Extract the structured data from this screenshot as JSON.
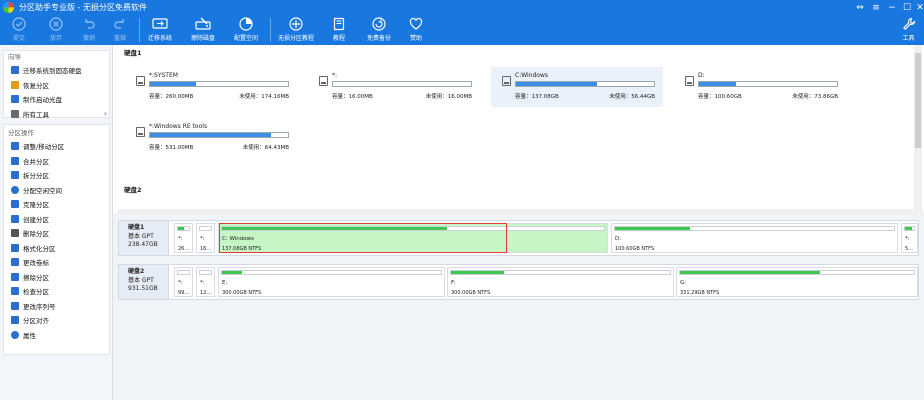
{
  "window": {
    "title": "分区助手专业版 - 无损分区免费软件"
  },
  "toolbar": {
    "buttons": [
      {
        "label": "提交",
        "icon": "check-icon",
        "disabled": true
      },
      {
        "label": "放弃",
        "icon": "cancel-icon",
        "disabled": true
      },
      {
        "label": "撤销",
        "icon": "undo-icon",
        "disabled": true
      },
      {
        "label": "重做",
        "icon": "redo-icon",
        "disabled": true
      },
      {
        "label": "迁移系统",
        "icon": "migrate-os-icon",
        "disabled": false
      },
      {
        "label": "擦除磁盘",
        "icon": "wipe-disk-icon",
        "disabled": false
      },
      {
        "label": "配置空间",
        "icon": "allocate-space-icon",
        "disabled": false
      },
      {
        "label": "无损分区教程",
        "icon": "tutorial-icon",
        "disabled": false
      },
      {
        "label": "教程",
        "icon": "book-icon",
        "disabled": false
      },
      {
        "label": "免费备份",
        "icon": "backup-icon",
        "disabled": false
      },
      {
        "label": "赞助",
        "icon": "heart-icon",
        "disabled": false
      }
    ],
    "tools_label": "工具"
  },
  "sidebar": {
    "wizard": {
      "title": "向导",
      "items": [
        "迁移系统到固态硬盘",
        "恢复分区",
        "制作启动光盘",
        "所有工具"
      ]
    },
    "partition_ops": {
      "title": "分区操作",
      "items": [
        "调整/移动分区",
        "合并分区",
        "拆分分区",
        "分配空闲空间",
        "克隆分区",
        "创建分区",
        "删除分区",
        "格式化分区",
        "更改卷标",
        "擦除分区",
        "检查分区",
        "更改序列号",
        "分区对齐",
        "属性"
      ]
    }
  },
  "disk1": {
    "label": "硬盘1",
    "partitions": [
      {
        "name": "*:SYSTEM",
        "capacity": "容量：260.00MB",
        "free": "未使用：174.16MB",
        "used_fraction": 0.33
      },
      {
        "name": "*:",
        "capacity": "容量：16.00MB",
        "free": "未使用：16.00MB",
        "used_fraction": 0.0
      },
      {
        "name": "C:Windows",
        "capacity": "容量：137.08GB",
        "free": "未使用：56.44GB",
        "used_fraction": 0.59
      },
      {
        "name": "D:",
        "capacity": "容量：100.60GB",
        "free": "未使用：73.86GB",
        "used_fraction": 0.27
      },
      {
        "name": "*:Windows RE tools",
        "capacity": "容量：531.00MB",
        "free": "未使用：64.43MB",
        "used_fraction": 0.88
      }
    ]
  },
  "disk2": {
    "label": "硬盘2"
  },
  "diskmap": {
    "disk1": {
      "name": "硬盘1",
      "type": "基本 GPT",
      "size": "238.47GB",
      "blocks": [
        {
          "name": "*:",
          "size": "26...",
          "used_fraction": 0.5
        },
        {
          "name": "*:",
          "size": "16...",
          "used_fraction": 0.0
        },
        {
          "name": "C: Windows",
          "size": "137.08GB NTFS",
          "used_fraction": 0.59
        },
        {
          "name": "D:",
          "size": "100.60GB NTFS",
          "used_fraction": 0.27
        },
        {
          "name": "*:",
          "size": "5...",
          "used_fraction": 0.8
        }
      ]
    },
    "disk2": {
      "name": "硬盘2",
      "type": "基本 GPT",
      "size": "931.51GB",
      "blocks": [
        {
          "name": "*:",
          "size": "99...",
          "used_fraction": 0.0
        },
        {
          "name": "*:",
          "size": "12...",
          "used_fraction": 0.0
        },
        {
          "name": "E:",
          "size": "300.00GB NTFS",
          "used_fraction": 0.09
        },
        {
          "name": "F:",
          "size": "300.00GB NTFS",
          "used_fraction": 0.24
        },
        {
          "name": "G:",
          "size": "331.29GB NTFS",
          "used_fraction": 0.6
        }
      ]
    }
  }
}
